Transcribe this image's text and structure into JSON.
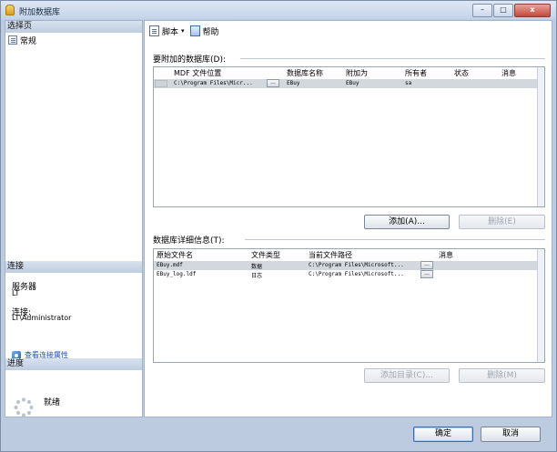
{
  "window": {
    "title": "附加数据库",
    "min_label": "–",
    "max_label": "□",
    "close_label": "x"
  },
  "left": {
    "select_page_header": "选择页",
    "nav_general": "常规",
    "connection_header": "连接",
    "server_label": "服务器",
    "server_value": "LT",
    "connection_label": "连接:",
    "connection_value": "LT\\Administrator",
    "view_connection_link": "查看连接属性",
    "progress_header": "进度",
    "progress_status": "就绪"
  },
  "toolbar": {
    "script_label": "脚本",
    "script_caret": "▾",
    "help_label": "帮助"
  },
  "attach": {
    "group_label": "要附加的数据库(D):",
    "columns": [
      "MDF 文件位置",
      "数据库名称",
      "附加为",
      "所有者",
      "状态",
      "消息"
    ],
    "rows": [
      {
        "mdf": "C:\\Program Files\\Micr...",
        "button": "...",
        "db_name": "EBuy",
        "attach_as": "EBuy",
        "owner": "sa",
        "status": "",
        "message": ""
      }
    ],
    "add_button": "添加(A)...",
    "remove_button": "删除(E)"
  },
  "details": {
    "group_label": "数据库详细信息(T):",
    "columns": [
      "原始文件名",
      "文件类型",
      "当前文件路径",
      "消息"
    ],
    "rows": [
      {
        "file": "EBuy.mdf",
        "type": "数据",
        "path": "C:\\Program Files\\Microsoft...",
        "button": "...",
        "message": ""
      },
      {
        "file": "EBuy_log.ldf",
        "type": "日志",
        "path": "C:\\Program Files\\Microsoft...",
        "button": "...",
        "message": ""
      }
    ],
    "add_catalog_button": "添加目录(C)...",
    "remove_button": "删除(M)"
  },
  "footer": {
    "ok_button": "确定",
    "cancel_button": "取消"
  }
}
